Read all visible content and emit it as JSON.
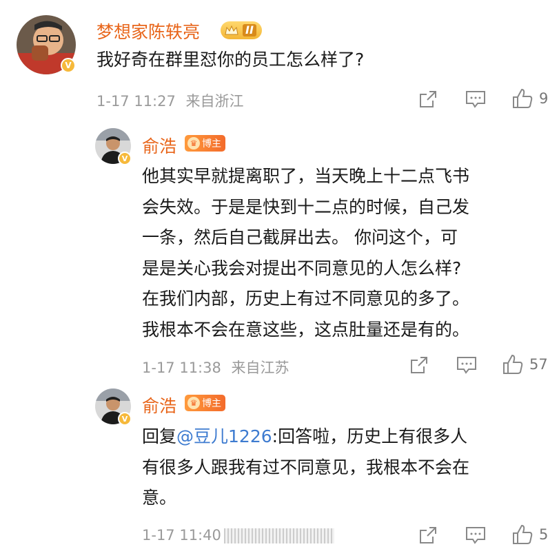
{
  "comments": [
    {
      "username": "梦想家陈轶亮",
      "level_badge": "II",
      "text": "我好奇在群里怼你的员工怎么样了?",
      "time": "1-17 11:27",
      "location": "来自浙江",
      "likes": "9"
    },
    {
      "username": "俞浩",
      "host_badge": "博主",
      "text": "他其实早就提离职了，当天晚上十二点飞书会失效。于是是快到十二点的时候，自己发一条，然后自己截屏出去。 你问这个，可是是关心我会对提出不同意见的人怎么样?在我们内部，历史上有过不同意见的多了。我根本不会在意这些，这点肚量还是有的。",
      "lines": [
        "他其实早就提离职了，当天晚上十二点飞书",
        "会失效。于是是快到十二点的时候，自己发",
        "一条，然后自己截屏出去。 你问这个，可",
        "是是关心我会对提出不同意见的人怎么样?",
        "在我们内部，历史上有过不同意见的多了。",
        "我根本不会在意这些，这点肚量还是有的。"
      ],
      "time": "1-17 11:38",
      "location": "来自江苏",
      "likes": "57"
    },
    {
      "username": "俞浩",
      "host_badge": "博主",
      "reply_prefix": "回复",
      "mention": "@豆儿1226",
      "reply_rest_line1": ":回答啦，历史上有很多人",
      "reply_line2": "有很多人跟我有过不同意见，我根本不会在",
      "reply_line3": "意。",
      "time": "1-17 11:40",
      "likes": "5"
    }
  ],
  "icons": {
    "share": "share-icon",
    "comment": "comment-icon",
    "like": "thumbs-up-icon",
    "verified": "verified-v-icon"
  },
  "colors": {
    "username": "#e8651a",
    "mention": "#3d7bd0",
    "meta": "#9a9a9a",
    "verified": "#f6b93b"
  }
}
